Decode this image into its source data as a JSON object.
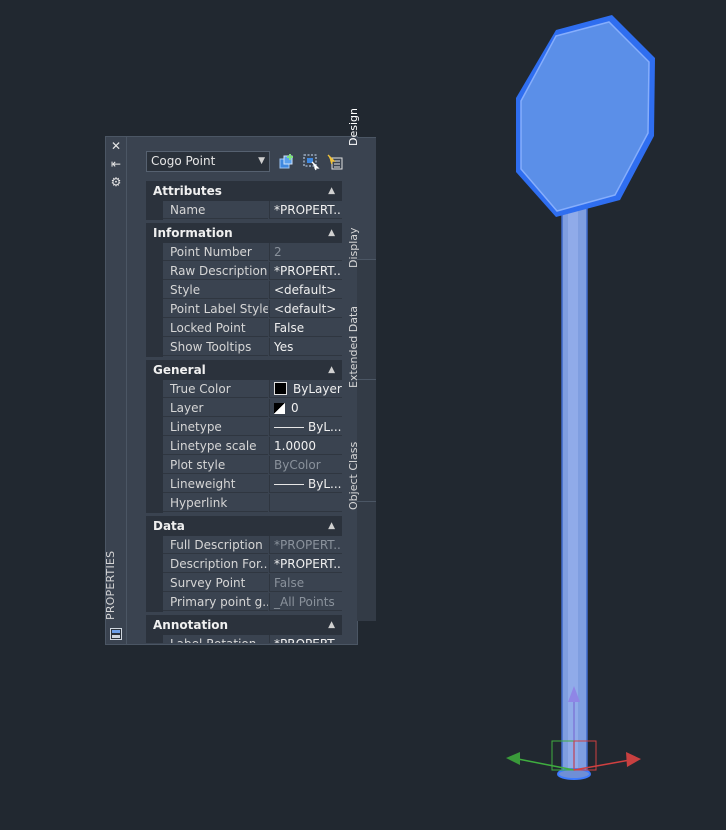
{
  "palette": {
    "title": "PROPERTIES",
    "object_type": "Cogo Point"
  },
  "tabs": [
    "Design",
    "Display",
    "Extended Data",
    "Object Class"
  ],
  "categories": {
    "attributes": "Attributes",
    "information": "Information",
    "general": "General",
    "data": "Data",
    "annotation": "Annotation"
  },
  "rows": {
    "name": {
      "label": "Name",
      "value": "*PROPERT..."
    },
    "point_number": {
      "label": "Point Number",
      "value": "2"
    },
    "raw_description": {
      "label": "Raw Description",
      "value": "*PROPERT..."
    },
    "style": {
      "label": "Style",
      "value": "<default>"
    },
    "point_label_style": {
      "label": "Point Label Style",
      "value": "<default>"
    },
    "locked_point": {
      "label": "Locked Point",
      "value": "False"
    },
    "show_tooltips": {
      "label": "Show Tooltips",
      "value": "Yes"
    },
    "true_color": {
      "label": "True Color",
      "value": "ByLayer"
    },
    "layer": {
      "label": "Layer",
      "value": "0"
    },
    "linetype": {
      "label": "Linetype",
      "value": "ByL..."
    },
    "linetype_scale": {
      "label": "Linetype scale",
      "value": "1.0000"
    },
    "plot_style": {
      "label": "Plot style",
      "value": "ByColor"
    },
    "lineweight": {
      "label": "Lineweight",
      "value": "ByL..."
    },
    "hyperlink": {
      "label": "Hyperlink",
      "value": ""
    },
    "full_description": {
      "label": "Full Description",
      "value": "*PROPERT..."
    },
    "description_format": {
      "label": "Description  For...",
      "value": "*PROPERT..."
    },
    "survey_point": {
      "label": "Survey Point",
      "value": "False"
    },
    "primary_point_group": {
      "label": "Primary point g...",
      "value": "_All Points"
    },
    "label_rotation": {
      "label": "Label Rotation",
      "value": "*PROPERT..."
    }
  },
  "colors": {
    "background": "#212830",
    "panel": "#3a4350",
    "sign_face": "#5b8fe8",
    "sign_edge": "#2f6ef0",
    "pole": "#7f9ee0"
  },
  "icons": [
    "close-icon",
    "autohide-icon",
    "settings-icon",
    "quick-select-icon",
    "select-objects-icon",
    "toggle-pickadd-icon",
    "properties-icon"
  ]
}
